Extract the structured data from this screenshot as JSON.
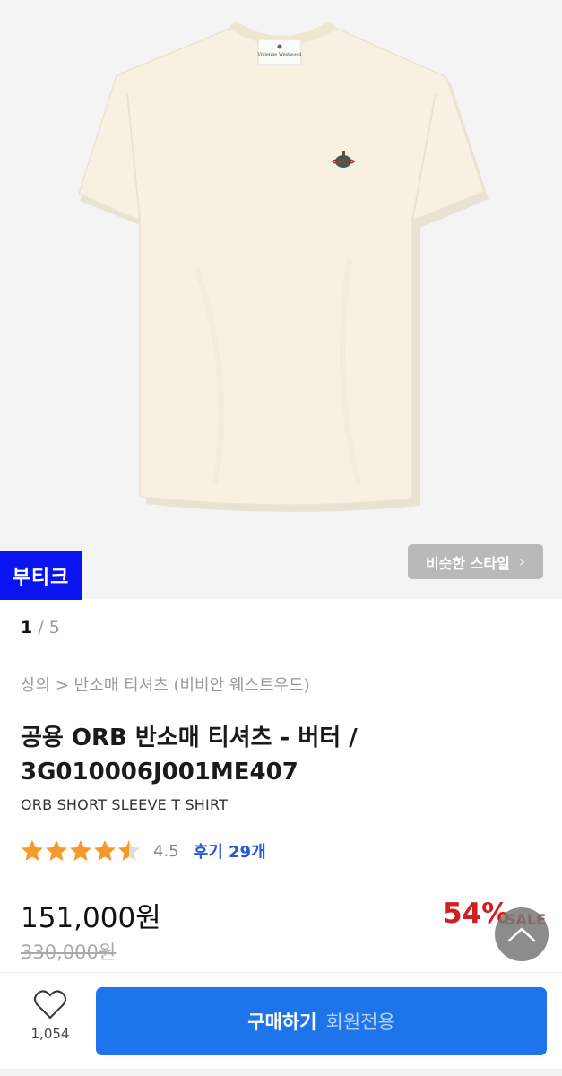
{
  "product_image": {
    "alt": "cream t-shirt",
    "shirt_color": "#f8f1e1",
    "background": "#f4f4f4",
    "label_text": "Vivienne Westwood"
  },
  "badge": {
    "label": "부티크"
  },
  "similar_style": {
    "label": "비슷한 스타일",
    "chevron": "›"
  },
  "pager": {
    "current": "1",
    "separator": " / ",
    "total": "5"
  },
  "breadcrumb": "상의 > 반소매 티셔츠 (비비안 웨스트우드)",
  "title": {
    "line1": "공용 ORB 반소매 티셔츠 - 버터 /",
    "line2": "3G010006J001ME407"
  },
  "subtitle": "ORB SHORT SLEEVE T SHIRT",
  "rating": {
    "value": "4.5",
    "stars": 4.5,
    "review_label": "후기 29개",
    "star_color": "#f39a2a"
  },
  "price": {
    "current": "151,000원",
    "original": "330,000원",
    "discount": "54%",
    "sale_tag": "SALE"
  },
  "like": {
    "count": "1,054"
  },
  "buy": {
    "label": "구매하기",
    "note": "회원전용",
    "color": "#1e74ea"
  }
}
